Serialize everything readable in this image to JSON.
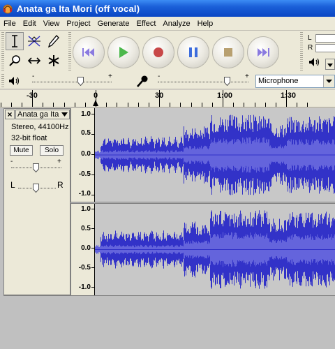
{
  "window": {
    "title": "Anata ga Ita Mori (off vocal)"
  },
  "menu": [
    "File",
    "Edit",
    "View",
    "Project",
    "Generate",
    "Effect",
    "Analyze",
    "Help"
  ],
  "tools": [
    {
      "name": "selection-tool",
      "icon": "i-beam-icon",
      "active": true
    },
    {
      "name": "envelope-tool",
      "icon": "envelope-icon",
      "active": false
    },
    {
      "name": "draw-tool",
      "icon": "pencil-icon",
      "active": false
    },
    {
      "name": "zoom-tool",
      "icon": "magnifier-icon",
      "active": false
    },
    {
      "name": "time-shift-tool",
      "icon": "double-arrow-icon",
      "active": false
    },
    {
      "name": "multi-tool",
      "icon": "asterisk-icon",
      "active": false
    }
  ],
  "transport": [
    "skip-to-start-icon",
    "play-icon",
    "record-icon",
    "pause-icon",
    "stop-icon",
    "skip-to-end-icon"
  ],
  "colors": {
    "skip": "#8a7ae0",
    "play": "#4cb84c",
    "record": "#c84848",
    "pause": "#3c6cdc",
    "stop": "#b8a070",
    "waveform_outer": "#3232c8",
    "waveform_inner": "#6464dc",
    "waveform_bg": "#c8c8c8"
  },
  "meter": {
    "left_label": "L",
    "right_label": "R"
  },
  "mixer": {
    "output_minus": "-",
    "output_plus": "+",
    "input_minus": "-",
    "input_plus": "+",
    "input_source": "Microphone"
  },
  "ruler": {
    "labels": [
      "-30",
      "0",
      "30",
      "1:00",
      "1:30"
    ]
  },
  "track": {
    "name": "Anata ga Ita",
    "format": "Stereo, 44100Hz",
    "bitdepth": "32-bit float",
    "mute_label": "Mute",
    "solo_label": "Solo",
    "gain_minus": "-",
    "gain_plus": "+",
    "pan_left": "L",
    "pan_right": "R",
    "scale_labels": [
      "1.0",
      "0.5",
      "0.0",
      "-0.5",
      "-1.0"
    ]
  }
}
